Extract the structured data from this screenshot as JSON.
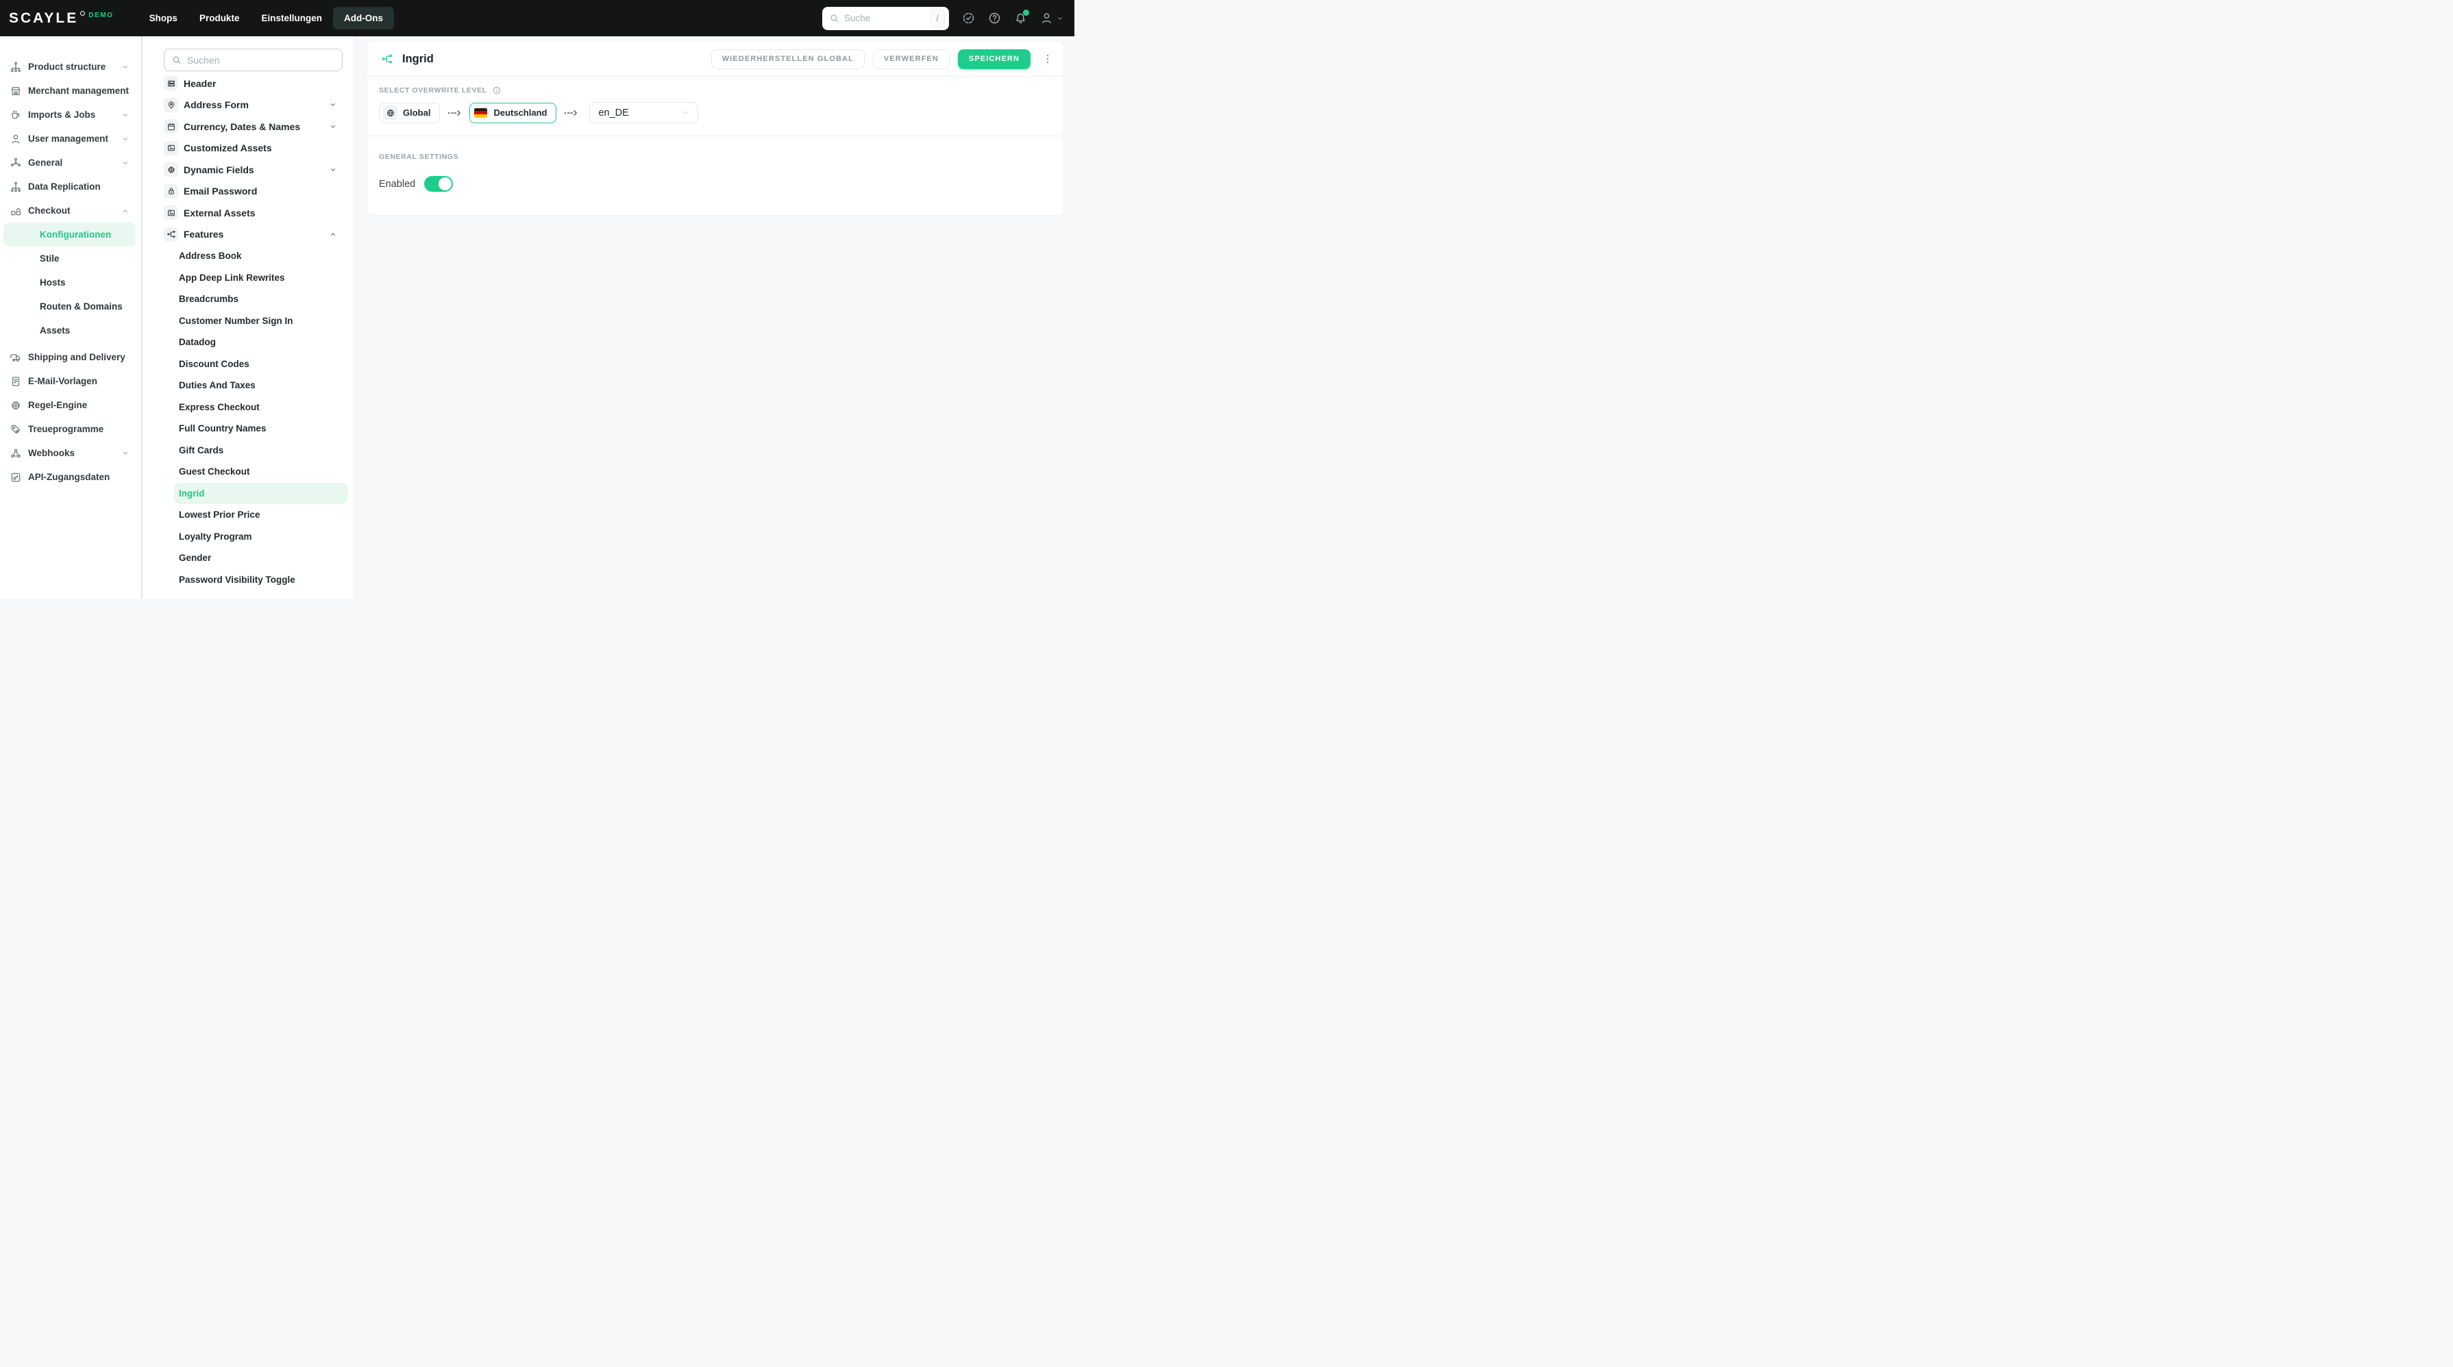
{
  "topbar": {
    "logo": "SCAYLE",
    "logo_badge": "DEMO",
    "nav": [
      {
        "label": "Shops",
        "active": false
      },
      {
        "label": "Produkte",
        "active": false
      },
      {
        "label": "Einstellungen",
        "active": false
      },
      {
        "label": "Add-Ons",
        "active": true
      }
    ],
    "search": {
      "placeholder": "Suche",
      "shortcut": "/"
    }
  },
  "sidebar": {
    "items": [
      {
        "label": "Product structure",
        "icon": "hierarchy",
        "chevron": "down"
      },
      {
        "label": "Merchant management",
        "icon": "store",
        "chevron": "down"
      },
      {
        "label": "Imports & Jobs",
        "icon": "cup",
        "chevron": "down"
      },
      {
        "label": "User management",
        "icon": "user",
        "chevron": "down"
      },
      {
        "label": "General",
        "icon": "nodes",
        "chevron": "down"
      },
      {
        "label": "Data Replication",
        "icon": "hierarchy",
        "chevron": null
      },
      {
        "label": "Checkout",
        "icon": "boxes",
        "chevron": "up",
        "children": [
          {
            "label": "Konfigurationen",
            "active": true
          },
          {
            "label": "Stile",
            "active": false
          },
          {
            "label": "Hosts",
            "active": false
          },
          {
            "label": "Routen & Domains",
            "active": false
          },
          {
            "label": "Assets",
            "active": false
          }
        ]
      },
      {
        "label": "Shipping and Delivery",
        "icon": "truck",
        "chevron": "down"
      },
      {
        "label": "E-Mail-Vorlagen",
        "icon": "document",
        "chevron": null
      },
      {
        "label": "Regel-Engine",
        "icon": "chip",
        "chevron": null
      },
      {
        "label": "Treueprogramme",
        "icon": "tag-heart",
        "chevron": null
      },
      {
        "label": "Webhooks",
        "icon": "webhook",
        "chevron": "down"
      },
      {
        "label": "API-Zugangsdaten",
        "icon": "key",
        "chevron": null
      }
    ]
  },
  "panel": {
    "search_placeholder": "Suchen",
    "items": [
      {
        "label": "Header",
        "icon": "rows",
        "chevron": null
      },
      {
        "label": "Address Form",
        "icon": "pin",
        "chevron": "down"
      },
      {
        "label": "Currency, Dates & Names",
        "icon": "calendar",
        "chevron": "down"
      },
      {
        "label": "Customized Assets",
        "icon": "image",
        "chevron": null
      },
      {
        "label": "Dynamic Fields",
        "icon": "chip",
        "chevron": "down"
      },
      {
        "label": "Email Password",
        "icon": "lock",
        "chevron": null
      },
      {
        "label": "External Assets",
        "icon": "image",
        "chevron": null
      },
      {
        "label": "Features",
        "icon": "branch",
        "chevron": "up",
        "children": [
          {
            "label": "Address Book",
            "active": false
          },
          {
            "label": "App Deep Link Rewrites",
            "active": false
          },
          {
            "label": "Breadcrumbs",
            "active": false
          },
          {
            "label": "Customer Number Sign In",
            "active": false
          },
          {
            "label": "Datadog",
            "active": false
          },
          {
            "label": "Discount Codes",
            "active": false
          },
          {
            "label": "Duties And Taxes",
            "active": false
          },
          {
            "label": "Express Checkout",
            "active": false
          },
          {
            "label": "Full Country Names",
            "active": false
          },
          {
            "label": "Gift Cards",
            "active": false
          },
          {
            "label": "Guest Checkout",
            "active": false
          },
          {
            "label": "Ingrid",
            "active": true
          },
          {
            "label": "Lowest Prior Price",
            "active": false
          },
          {
            "label": "Loyalty Program",
            "active": false
          },
          {
            "label": "Gender",
            "active": false
          },
          {
            "label": "Password Visibility Toggle",
            "active": false
          }
        ]
      }
    ]
  },
  "main": {
    "title": "Ingrid",
    "actions": {
      "restore": "WIEDERHERSTELLEN GLOBAL",
      "discard": "VERWERFEN",
      "save": "SPEICHERN"
    },
    "overwrite": {
      "label": "SELECT OVERWRITE LEVEL",
      "global_label": "Global",
      "country_label": "Deutschland",
      "locale_value": "en_DE"
    },
    "settings": {
      "section": "GENERAL SETTINGS",
      "enabled_label": "Enabled",
      "enabled": true
    }
  },
  "colors": {
    "accent": "#1ecd8c",
    "active_text": "#27c486",
    "active_bg": "#e9f7f1"
  }
}
